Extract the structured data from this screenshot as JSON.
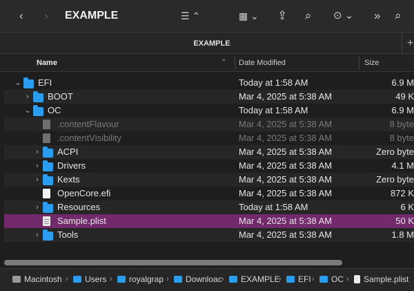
{
  "window": {
    "title": "EXAMPLE",
    "toolbar": {
      "back": "‹",
      "forward": "›",
      "list_view": "☰ ⌃",
      "group_view": "▦ ⌄",
      "share": "⇪",
      "tags": "⌕",
      "more": "⊙ ⌄",
      "overflow": "»",
      "search": "⌕"
    }
  },
  "tab": {
    "label": "EXAMPLE",
    "add": "+"
  },
  "columns": {
    "name": "Name",
    "date": "Date Modified",
    "size": "Size",
    "sort": "⌃"
  },
  "rows": [
    {
      "name": "EFI",
      "date": "Today at 1:58 AM",
      "size": "6.9 M",
      "icon": "folder-icon",
      "expanded": true,
      "indent": 0
    },
    {
      "name": "BOOT",
      "date": "Mar 4, 2025 at 5:38 AM",
      "size": "49 K",
      "icon": "folder-icon",
      "expanded": false,
      "indent": 1
    },
    {
      "name": "OC",
      "date": "Today at 1:58 AM",
      "size": "6.9 M",
      "icon": "folder-icon",
      "expanded": true,
      "indent": 1
    },
    {
      "name": ".contentFlavour",
      "date": "Mar 4, 2025 at 5:38 AM",
      "size": "8 byte",
      "icon": "document-icon",
      "hidden": true,
      "indent": 2
    },
    {
      "name": ".contentVisibility",
      "date": "Mar 4, 2025 at 5:38 AM",
      "size": "8 byte",
      "icon": "document-icon",
      "hidden": true,
      "indent": 2
    },
    {
      "name": "ACPI",
      "date": "Mar 4, 2025 at 5:38 AM",
      "size": "Zero byte",
      "icon": "folder-icon",
      "expanded": false,
      "indent": 2
    },
    {
      "name": "Drivers",
      "date": "Mar 4, 2025 at 5:38 AM",
      "size": "4.1 M",
      "icon": "folder-icon",
      "expanded": false,
      "indent": 2
    },
    {
      "name": "Kexts",
      "date": "Mar 4, 2025 at 5:38 AM",
      "size": "Zero byte",
      "icon": "folder-icon",
      "expanded": false,
      "indent": 2
    },
    {
      "name": "OpenCore.efi",
      "date": "Mar 4, 2025 at 5:38 AM",
      "size": "872 K",
      "icon": "document-icon",
      "indent": 2
    },
    {
      "name": "Resources",
      "date": "Today at 1:58 AM",
      "size": "6 K",
      "icon": "folder-icon",
      "expanded": false,
      "indent": 2
    },
    {
      "name": "Sample.plist",
      "date": "Mar 4, 2025 at 5:38 AM",
      "size": "50 K",
      "icon": "plist-icon",
      "selected": true,
      "indent": 2
    },
    {
      "name": "Tools",
      "date": "Mar 4, 2025 at 5:38 AM",
      "size": "1.8 M",
      "icon": "folder-icon",
      "expanded": false,
      "indent": 2
    }
  ],
  "path": [
    {
      "label": "Macintosh",
      "icon": "disk-icon"
    },
    {
      "label": "Users",
      "icon": "folder-icon"
    },
    {
      "label": "royalgrap",
      "icon": "folder-icon"
    },
    {
      "label": "Downloac",
      "icon": "folder-icon"
    },
    {
      "label": "EXAMPLE",
      "icon": "folder-icon"
    },
    {
      "label": "EFI",
      "icon": "folder-icon"
    },
    {
      "label": "OC",
      "icon": "folder-icon"
    },
    {
      "label": "Sample.plist",
      "icon": "plist-icon"
    }
  ],
  "path_separator": "›",
  "colors": {
    "selection": "#722a6c",
    "folder": "#2b9dee",
    "background": "#1e1e1e"
  }
}
